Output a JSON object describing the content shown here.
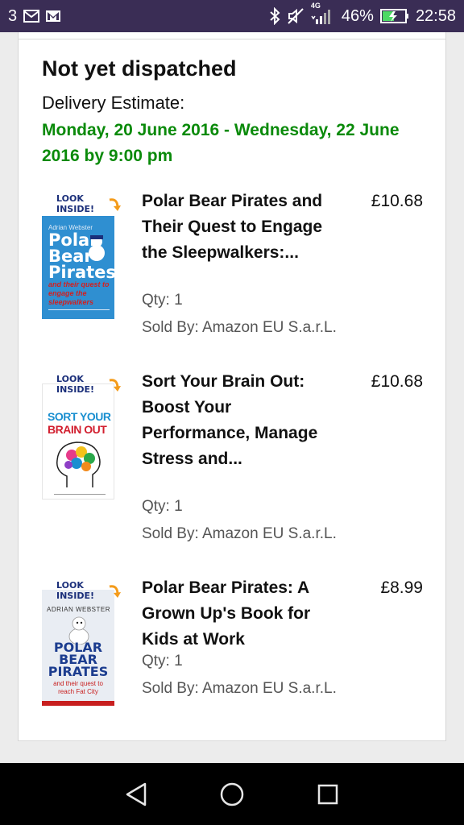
{
  "status_bar": {
    "notification_count": "3",
    "left_icons": [
      "mail-icon",
      "gmail-icon"
    ],
    "right_icons": [
      "bluetooth-icon",
      "mute-icon",
      "signal-4g-icon",
      "battery-charging-icon"
    ],
    "network": "4G",
    "battery": "46%",
    "time": "22:58"
  },
  "shipment": {
    "status": "Not yet dispatched",
    "delivery_label": "Delivery Estimate:",
    "delivery_dates": "Monday, 20 June 2016 - Wednesday, 22 June 2016 by 9:00 pm"
  },
  "items": [
    {
      "title": "Polar Bear Pirates and Their Quest to Engage the Sleepwalkers:...",
      "price": "£10.68",
      "qty": "Qty: 1",
      "seller": "Sold By: Amazon EU S.a.r.L.",
      "cover": {
        "look_inside": "LOOK INSIDE!",
        "author": "Adrian Webster",
        "title_line1": "Polar",
        "title_line2": "Bear",
        "title_line3": "Pirates",
        "subtitle": "and their quest to engage the sleepwalkers",
        "colors": {
          "bg": "#2f8fd1",
          "title": "#ffffff",
          "subtitle": "#d22020"
        }
      }
    },
    {
      "title": "Sort Your Brain Out: Boost Your Performance, Manage Stress and...",
      "price": "£10.68",
      "qty": "Qty: 1",
      "seller": "Sold By: Amazon EU S.a.r.L.",
      "cover": {
        "look_inside": "LOOK INSIDE!",
        "title_line1": "SORT YOUR",
        "title_line2": "BRAIN OUT",
        "colors": {
          "bg": "#ffffff",
          "title1": "#1a8fd0",
          "title2": "#d21f2f"
        }
      }
    },
    {
      "title": "Polar Bear Pirates: A Grown Up's Book for Kids at Work",
      "price": "£8.99",
      "qty": "Qty: 1",
      "seller": "Sold By: Amazon EU S.a.r.L.",
      "cover": {
        "look_inside": "LOOK INSIDE!",
        "author": "ADRIAN WEBSTER",
        "title_line1": "POLAR",
        "title_line2": "BEAR",
        "title_line3": "PIRATES",
        "subtitle": "and their quest to reach Fat City",
        "colors": {
          "bg": "#e9edf3",
          "title": "#1c3d8f",
          "subtitle": "#c81f1f",
          "band": "#c81f1f"
        }
      }
    }
  ],
  "nav_bar": {
    "buttons": [
      "back-icon",
      "home-icon",
      "recents-icon"
    ]
  }
}
